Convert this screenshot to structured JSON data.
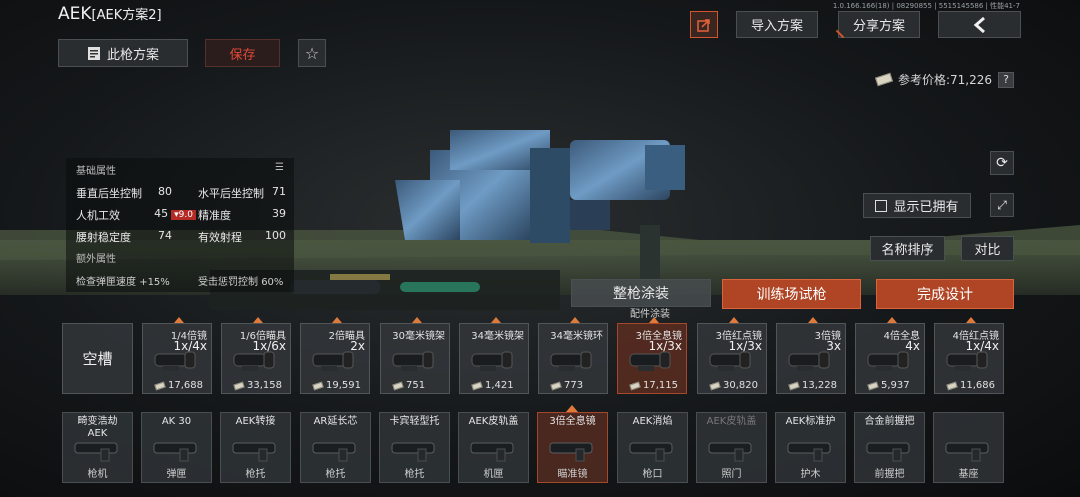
{
  "header": {
    "weapon": "AEK",
    "plan": "[AEK方案2]",
    "version": "1.0.166.166(18) | 08290855 | 5515145586 | 性能41-7",
    "import_label": "导入方案",
    "share_label": "分享方案",
    "back_icon": "chevron-left-icon",
    "share_icon": "share-icon",
    "this_gun_label": "此枪方案",
    "save_label": "保存",
    "price_label": "参考价格:",
    "price_value": "71,226",
    "help": "?"
  },
  "attributes": {
    "section_title": "基础属性",
    "rows": [
      {
        "label": "垂直后坐控制",
        "value": "80"
      },
      {
        "label": "水平后坐控制",
        "value": "71"
      },
      {
        "label": "人机工效",
        "value": "45"
      },
      {
        "label": "精准度",
        "value": "39"
      },
      {
        "label": "腰射稳定度",
        "value": "74"
      },
      {
        "label": "有效射程",
        "value": "100"
      }
    ],
    "ergonomics_delta": "9.0",
    "extra_title": "额外属性",
    "extra_rows": [
      {
        "label": "检查弹匣速度",
        "value": "+15%"
      },
      {
        "label": "受击惩罚控制",
        "value": "60%"
      }
    ]
  },
  "controls": {
    "show_owned_label": "显示已拥有",
    "sort_name_label": "名称排序",
    "compare_label": "对比",
    "paint_label": "整枪涂装",
    "paint_sub": "配件涂装",
    "range_label": "训练场试枪",
    "done_label": "完成设计"
  },
  "options": {
    "empty_label": "空槽",
    "items": [
      {
        "name": "1/4倍镜",
        "mag": "1x/4x",
        "price": "17,688"
      },
      {
        "name": "1/6倍瞄具",
        "mag": "1x/6x",
        "price": "33,158"
      },
      {
        "name": "2倍瞄具",
        "mag": "2x",
        "price": "19,591"
      },
      {
        "name": "30毫米镜架",
        "mag": "",
        "price": "751"
      },
      {
        "name": "34毫米镜架",
        "mag": "",
        "price": "1,421"
      },
      {
        "name": "34毫米镜环",
        "mag": "",
        "price": "773"
      },
      {
        "name": "3倍全息镜",
        "mag": "1x/3x",
        "price": "17,115"
      },
      {
        "name": "3倍红点镜",
        "mag": "1x/3x",
        "price": "30,820"
      },
      {
        "name": "3倍镜",
        "mag": "3x",
        "price": "13,228"
      },
      {
        "name": "4倍全息",
        "mag": "4x",
        "price": "5,937"
      },
      {
        "name": "4倍红点镜",
        "mag": "1x/4x",
        "price": "11,686"
      }
    ]
  },
  "parts": [
    {
      "name": "畸变浩劫\nAEK",
      "slot": "枪机"
    },
    {
      "name": "AK 30",
      "slot": "弹匣"
    },
    {
      "name": "AEK转接",
      "slot": "枪托"
    },
    {
      "name": "AR延长芯",
      "slot": "枪托"
    },
    {
      "name": "卡宾轻型托",
      "slot": "枪托"
    },
    {
      "name": "AEK皮轨盖",
      "slot": "机匣"
    },
    {
      "name": "3倍全息镜",
      "slot": "瞄准镜"
    },
    {
      "name": "AEK消焰",
      "slot": "枪口"
    },
    {
      "name": "AEK皮轨盖",
      "slot": "照门"
    },
    {
      "name": "AEK标准护",
      "slot": "护木"
    },
    {
      "name": "合金前握把",
      "slot": "前握把"
    },
    {
      "name": "",
      "slot": "基座"
    }
  ],
  "colors": {
    "accent": "#b04526",
    "danger": "#e24a3a",
    "panel": "#2a2d2f"
  }
}
